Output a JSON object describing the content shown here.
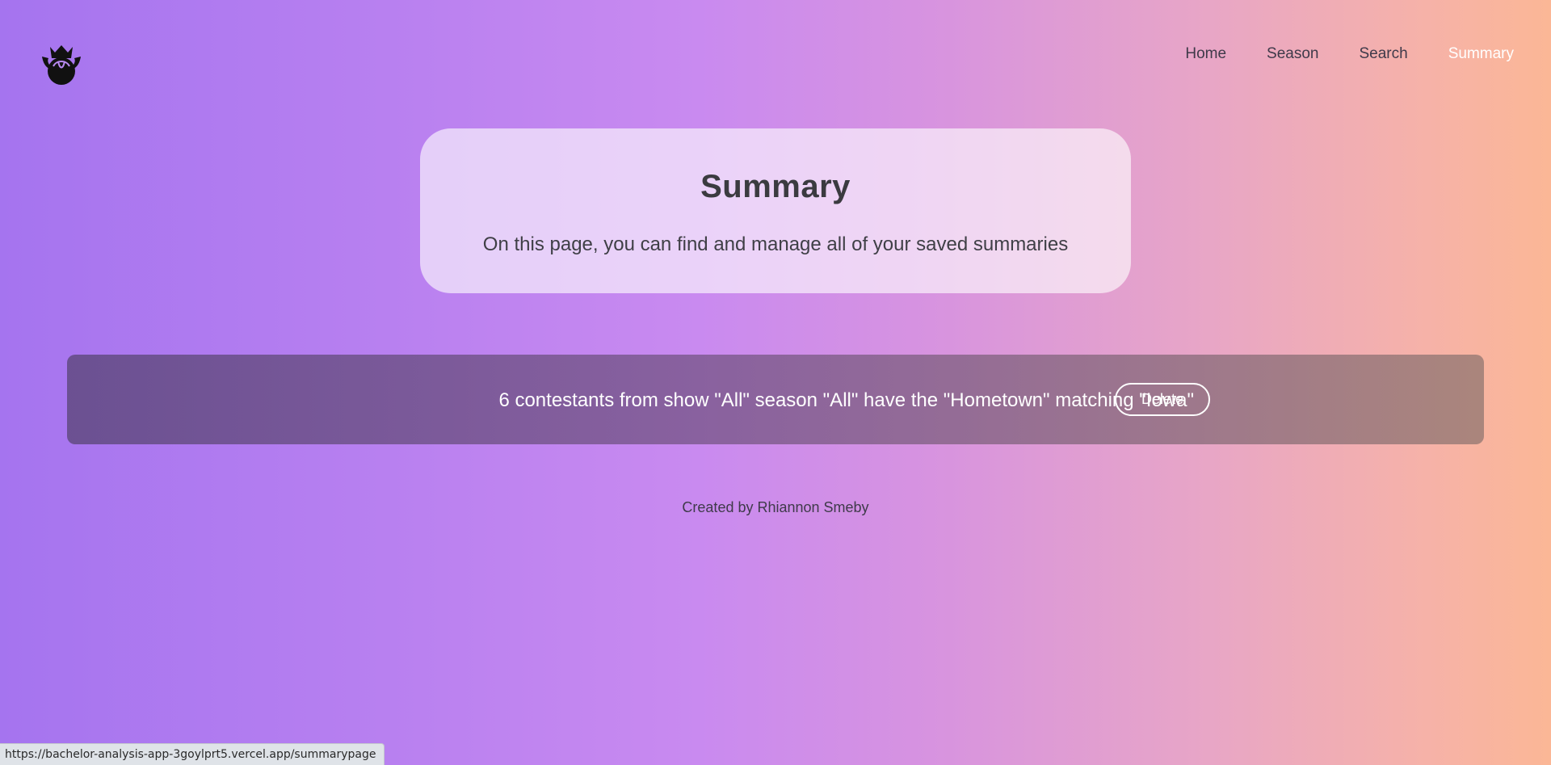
{
  "header": {
    "logo_icon": "rose-icon",
    "nav": [
      {
        "label": "Home",
        "active": false
      },
      {
        "label": "Season",
        "active": false
      },
      {
        "label": "Search",
        "active": false
      },
      {
        "label": "Summary",
        "active": true
      }
    ]
  },
  "hero": {
    "title": "Summary",
    "subtitle": "On this page, you can find and manage all of your saved summaries"
  },
  "summaries": [
    {
      "text": "6 contestants from show \"All\" season \"All\" have the \"Hometown\" matching \"Iowa\"",
      "delete_label": "Delete"
    }
  ],
  "footer": {
    "credit": "Created by Rhiannon Smeby"
  },
  "status_bar": {
    "url": "https://bachelor-analysis-app-3goylprt5.vercel.app/summarypage"
  },
  "colors": {
    "gradient_start": "#a574ef",
    "gradient_mid": "#c98af0",
    "gradient_end": "#fbb796",
    "nav_active": "#ffffff",
    "nav_default": "#3f3a4a"
  }
}
